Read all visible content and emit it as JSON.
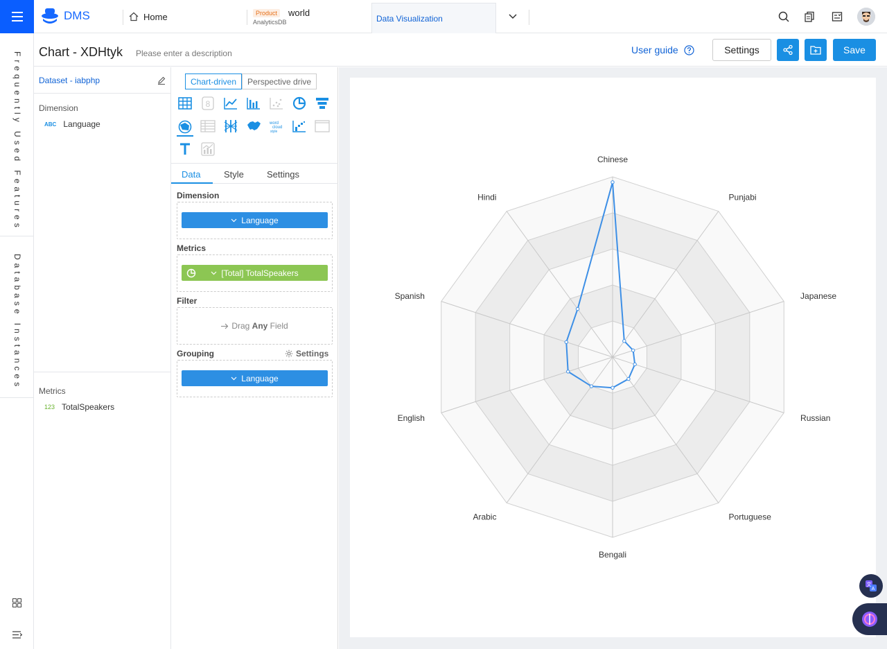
{
  "topbar": {
    "logo_text": "DMS",
    "tabs": [
      {
        "label": "Home"
      },
      {
        "badge": "Product",
        "label": "world",
        "sub": "AnalyticsDB"
      },
      {
        "label": "Data Visualization"
      }
    ]
  },
  "rail": {
    "frequent": "Frequently Used Features",
    "db": "Database Instances"
  },
  "header": {
    "title": "Chart - XDHtyk",
    "description_placeholder": "Please enter a description",
    "user_guide": "User guide",
    "settings": "Settings",
    "save": "Save"
  },
  "dataset": {
    "name": "Dataset - iabphp",
    "dimension_label": "Dimension",
    "dimensions": [
      {
        "tag": "ABC",
        "name": "Language"
      }
    ],
    "metrics_label": "Metrics",
    "metrics": [
      {
        "tag": "123",
        "name": "TotalSpeakers"
      }
    ]
  },
  "config": {
    "mode_tabs": [
      "Chart-driven",
      "Perspective drive"
    ],
    "tabs": [
      "Data",
      "Style",
      "Settings"
    ],
    "dimension_label": "Dimension",
    "dimension_pill": "Language",
    "metrics_label": "Metrics",
    "metric_pill": "[Total] TotalSpeakers",
    "filter_label": "Filter",
    "filter_hint_pre": "Drag ",
    "filter_hint_bold": "Any",
    "filter_hint_post": " Field",
    "grouping_label": "Grouping",
    "grouping_settings": "Settings",
    "grouping_pill": "Language"
  },
  "chart_data": {
    "type": "radar",
    "indicators": [
      "Chinese",
      "Punjabi",
      "Japanese",
      "Russian",
      "Portuguese",
      "Bengali",
      "Arabic",
      "English",
      "Spanish",
      "Hindi"
    ],
    "series": [
      {
        "values": [
          0.97,
          0.11,
          0.12,
          0.13,
          0.15,
          0.17,
          0.2,
          0.26,
          0.27,
          0.33
        ]
      }
    ],
    "rings": 5,
    "line_color": "#3d8fe6"
  },
  "colors": {
    "accent": "#1a8fe3",
    "menu": "#0a5eff",
    "metric_green": "#8cc653"
  }
}
